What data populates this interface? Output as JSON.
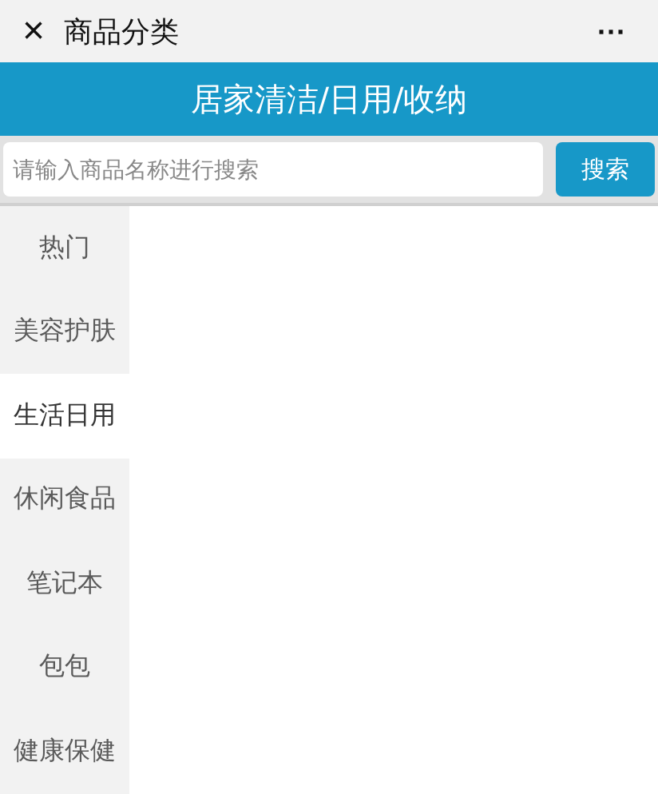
{
  "window": {
    "title": "商品分类",
    "close": "×",
    "more": "···"
  },
  "header": {
    "title": "居家清洁/日用/收纳"
  },
  "search": {
    "placeholder": "请输入商品名称进行搜索",
    "button": "搜索"
  },
  "sidebar": {
    "items": [
      {
        "label": "热门",
        "selected": false
      },
      {
        "label": "美容护肤",
        "selected": false
      },
      {
        "label": "生活日用",
        "selected": true
      },
      {
        "label": "休闲食品",
        "selected": false
      },
      {
        "label": "笔记本",
        "selected": false
      },
      {
        "label": "包包",
        "selected": false
      },
      {
        "label": "健康保健",
        "selected": false
      }
    ]
  }
}
